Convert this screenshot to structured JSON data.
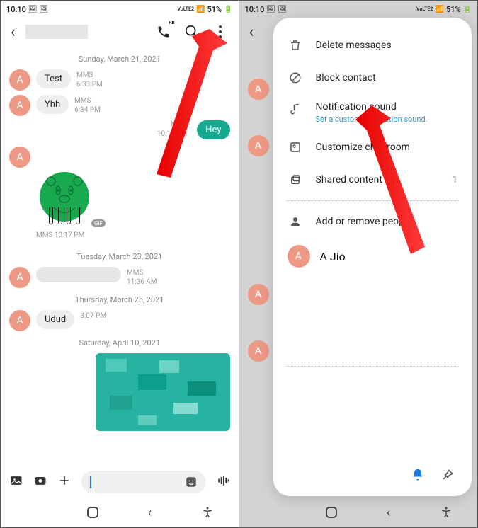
{
  "status_bar": {
    "time": "10:10",
    "battery": "51%",
    "volte": "VoLTE2",
    "signal_icon": "signal-icon",
    "battery_icon": "battery-icon"
  },
  "left": {
    "dates": {
      "d1": "Sunday, March 21, 2021",
      "d2": "Tuesday, March 23, 2021",
      "d3": "Thursday, March 25, 2021",
      "d4": "Saturday, April 10, 2021"
    },
    "avatar_letter": "A",
    "msgs": {
      "m1": {
        "text": "Test",
        "type": "MMS",
        "time": "6:33 PM"
      },
      "m2": {
        "text": "Yhh",
        "type": "MMS",
        "time": "6:34 PM"
      },
      "m3_out": {
        "text": "Hey",
        "type": "MMS",
        "time": "10:17 PM"
      },
      "m3_sticker_meta": "MMS 10:17 PM",
      "m3_gif": "GIF",
      "m4": {
        "type": "MMS",
        "time": "11:36 AM"
      },
      "m5": {
        "text": "Udud",
        "time": "3:07 PM"
      }
    }
  },
  "right": {
    "avatar_letter": "A",
    "menu": {
      "delete": "Delete messages",
      "block": "Block contact",
      "notif": "Notification sound",
      "notif_sub": "Set a custom notification sound.",
      "customize": "Customize chat room",
      "shared": "Shared content",
      "shared_count": "1",
      "add_people": "Add or remove people",
      "contact": "A Jio"
    }
  }
}
